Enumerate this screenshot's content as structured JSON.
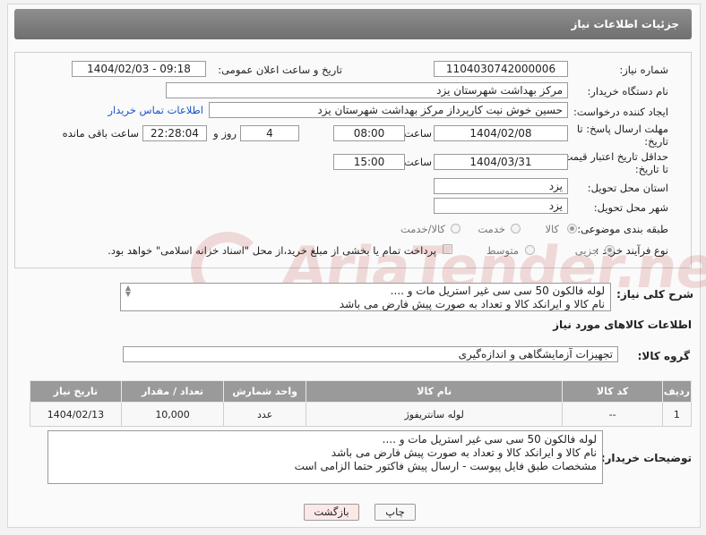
{
  "header": {
    "title": "جزئیات اطلاعات نیاز"
  },
  "form": {
    "need_number": {
      "label": "شماره نیاز:",
      "value": "1104030742000006"
    },
    "announce_datetime": {
      "label": "تاریخ و ساعت اعلان عمومی:",
      "value": "1404/02/03 - 09:18"
    },
    "buyer_org": {
      "label": "نام دستگاه خریدار:",
      "value": "مرکز بهداشت شهرستان یزد"
    },
    "creator": {
      "label": "ایجاد کننده درخواست:",
      "value": "حسین خوش نیت کارپرداز مرکز بهداشت شهرستان یزد",
      "contact_link": "اطلاعات تماس خریدار"
    },
    "response_deadline": {
      "label_line1": "مهلت ارسال پاسخ: تا",
      "label_line2": "تاریخ:",
      "date": "1404/02/08",
      "time_label": "ساعت",
      "time": "08:00",
      "days": "4",
      "days_label": "روز و",
      "remaining": "22:28:04",
      "remaining_label": "ساعت باقی مانده"
    },
    "price_validity": {
      "label_line1": "حداقل تاریخ اعتبار قیمت:",
      "label_line2": "تا تاریخ:",
      "date": "1404/03/31",
      "time_label": "ساعت",
      "time": "15:00"
    },
    "delivery_province": {
      "label": "استان محل تحویل:",
      "value": "یزد"
    },
    "delivery_city": {
      "label": "شهر محل تحویل:",
      "value": "یزد"
    },
    "category": {
      "label": "طبقه بندی موضوعی:",
      "options": [
        "کالا",
        "خدمت",
        "کالا/خدمت"
      ],
      "selected": 0
    },
    "purchase_type": {
      "label": "نوع فرآیند خرید :",
      "options": [
        "جزیی",
        "متوسط"
      ],
      "selected": 0,
      "payment_note": "پرداخت تمام یا بخشی از مبلغ خرید،از محل \"اسناد خزانه اسلامی\" خواهد بود."
    }
  },
  "summary": {
    "label": "شرح کلی نیاز:",
    "lines": [
      "لوله فالکون 50 سی سی غیر استریل مات و ....",
      "نام کالا و ایرانکد کالا و تعداد به صورت پیش فارض می باشد"
    ]
  },
  "goods": {
    "section_title": "اطلاعات کالاهای مورد نیاز",
    "group_label": "گروه کالا:",
    "group_value": "تجهیزات آزمایشگاهی و اندازه‌گیری",
    "columns": [
      "ردیف",
      "کد کالا",
      "نام کالا",
      "واحد شمارش",
      "تعداد / مقدار",
      "تاریخ نیاز"
    ],
    "rows": [
      {
        "index": "1",
        "code": "--",
        "name": "لوله سانتریفوژ",
        "unit": "عدد",
        "qty": "10,000",
        "date": "1404/02/13"
      }
    ]
  },
  "buyer_notes": {
    "label": "توضیحات خریدار:",
    "lines": [
      "لوله فالکون 50 سی سی غیر استریل مات و ....",
      "نام کالا و ایرانکد کالا و تعداد به صورت پیش فارض می باشد",
      "مشخصات طبق فایل پیوست - ارسال پیش فاکتور حتما الزامی است"
    ]
  },
  "buttons": {
    "print": "چاپ",
    "back": "بازگشت"
  },
  "watermark": {
    "text": "AriaTender.neT"
  },
  "colors": {
    "header_bg": "#7f7f7f",
    "table_header_bg": "#9a9a9a",
    "link": "#1a55c4",
    "back_button_bg": "#fde8e8"
  }
}
